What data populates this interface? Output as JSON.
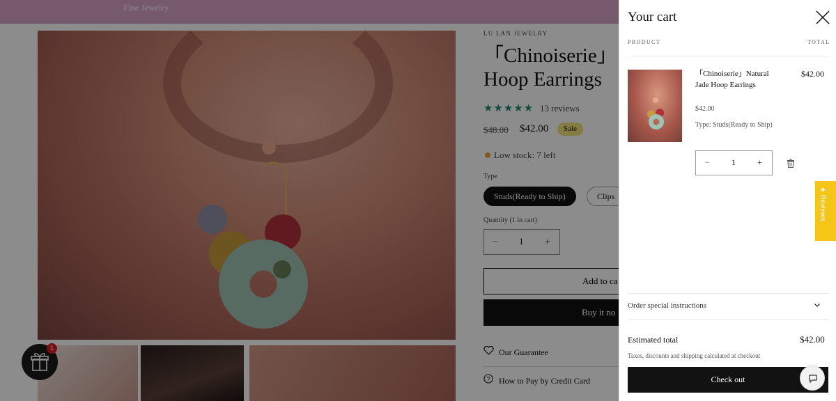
{
  "announcement": {
    "tagline": "Fine Jewelry"
  },
  "product": {
    "brand": "LU LAN JEWELRY",
    "title_line1": "「Chinoiserie」",
    "title_line2": "Hoop Earrings",
    "stars": "★★★★★",
    "reviews_count": "13 reviews",
    "compare_price": "$48.00",
    "price": "$42.00",
    "sale_badge": "Sale",
    "stock": "Low stock: 7 left",
    "type_label": "Type",
    "variants": [
      {
        "label": "Studs(Ready to Ship)",
        "selected": true
      },
      {
        "label": "Clips",
        "selected": false
      }
    ],
    "quantity_label": "Quantity (1 in cart)",
    "quantity": "1",
    "add_to_cart": "Add to ca",
    "buy_now": "Buy it no",
    "links": [
      "Our Guarantee",
      "How to Pay by Credit Card"
    ]
  },
  "gift": {
    "badge": "1"
  },
  "reviews_tab": {
    "label": "★ Reviews",
    "color": "#f5c518"
  },
  "cart": {
    "title": "Your cart",
    "col_product": "PRODUCT",
    "col_total": "TOTAL",
    "item": {
      "name": "「Chinoiserie」Natural Jade Hoop Earrings",
      "price": "$42.00",
      "variant": "Type: Studs(Ready to Ship)",
      "quantity": "1",
      "line_total": "$42.00"
    },
    "instructions_label": "Order special instructions",
    "estimated_label": "Estimated total",
    "estimated_value": "$42.00",
    "tax_note": "Taxes, discounts and shipping calculated at checkout",
    "checkout_label": "Check out"
  },
  "icons": {
    "close": "close-icon",
    "trash": "trash-icon",
    "chevron": "chevron-down-icon",
    "gift": "gift-icon",
    "heart": "heart-icon",
    "question": "question-icon",
    "chat": "chat-icon"
  }
}
